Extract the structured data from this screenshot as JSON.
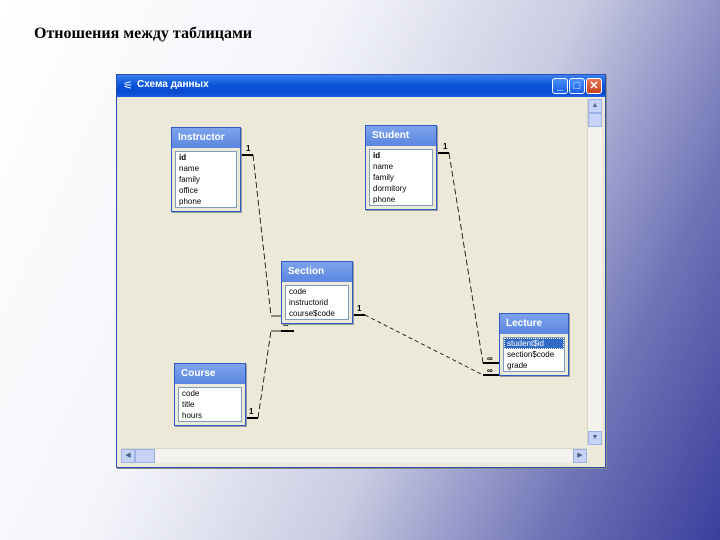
{
  "slide": {
    "title": "Отношения между таблицами"
  },
  "window": {
    "title": "Схема данных",
    "minimize": "_",
    "maximize": "□",
    "close": "✕",
    "app_icon": "relationships-icon"
  },
  "tables": {
    "instructor": {
      "title": "Instructor",
      "fields": [
        "id",
        "name",
        "family",
        "office",
        "phone"
      ]
    },
    "student": {
      "title": "Student",
      "fields": [
        "id",
        "name",
        "family",
        "dormitory",
        "phone"
      ]
    },
    "section": {
      "title": "Section",
      "fields": [
        "code",
        "instructorid",
        "course$code"
      ]
    },
    "course": {
      "title": "Course",
      "fields": [
        "code",
        "title",
        "hours"
      ]
    },
    "lecture": {
      "title": "Lecture",
      "fields": [
        "student$id",
        "section$code",
        "grade"
      ],
      "selected_field": "student$id"
    }
  },
  "relationships": [
    {
      "from": "Instructor.id",
      "to": "Section.instructorid",
      "one": "1",
      "many": "∞"
    },
    {
      "from": "Course.code",
      "to": "Section.course$code",
      "one": "1",
      "many": "∞"
    },
    {
      "from": "Student.id",
      "to": "Lecture.student$id",
      "one": "1",
      "many": "∞"
    },
    {
      "from": "Section.code",
      "to": "Lecture.section$code",
      "one": "1",
      "many": "∞"
    }
  ],
  "labels": {
    "one": "1",
    "many": "∞"
  }
}
